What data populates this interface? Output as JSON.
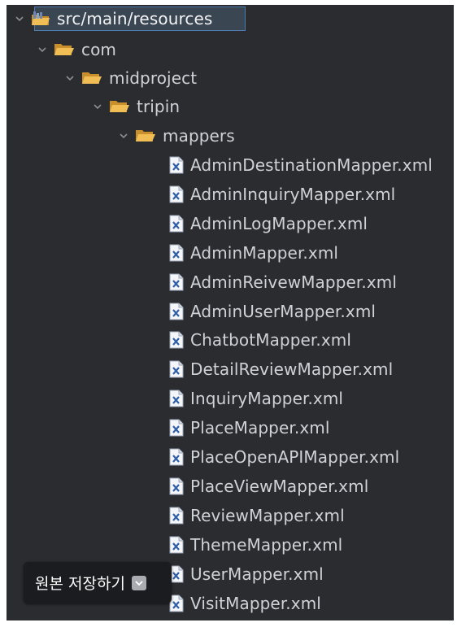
{
  "tree": {
    "root": {
      "label": "src/main/resources",
      "icon": "source-folder-icon"
    },
    "folders": [
      {
        "label": "com",
        "icon": "folder-open-icon"
      },
      {
        "label": "midproject",
        "icon": "folder-open-icon"
      },
      {
        "label": "tripin",
        "icon": "folder-open-icon"
      },
      {
        "label": "mappers",
        "icon": "folder-open-icon"
      }
    ],
    "files": [
      "AdminDestinationMapper.xml",
      "AdminInquiryMapper.xml",
      "AdminLogMapper.xml",
      "AdminMapper.xml",
      "AdminReivewMapper.xml",
      "AdminUserMapper.xml",
      "ChatbotMapper.xml",
      "DetailReviewMapper.xml",
      "InquiryMapper.xml",
      "PlaceMapper.xml",
      "PlaceOpenAPIMapper.xml",
      "PlaceViewMapper.xml",
      "ReviewMapper.xml",
      "ThemeMapper.xml",
      "UserMapper.xml",
      "VisitMapper.xml"
    ],
    "file_icon": "xml-file-icon"
  },
  "overlay": {
    "save_original_label": "원본 저장하기",
    "icon": "chevron-down-icon"
  },
  "colors": {
    "panel_bg": "#2b2c2f",
    "text": "#cfd2d6",
    "folder": "#e8b54a",
    "selection": "#3b4653",
    "selection_border": "#4f7ab0"
  }
}
